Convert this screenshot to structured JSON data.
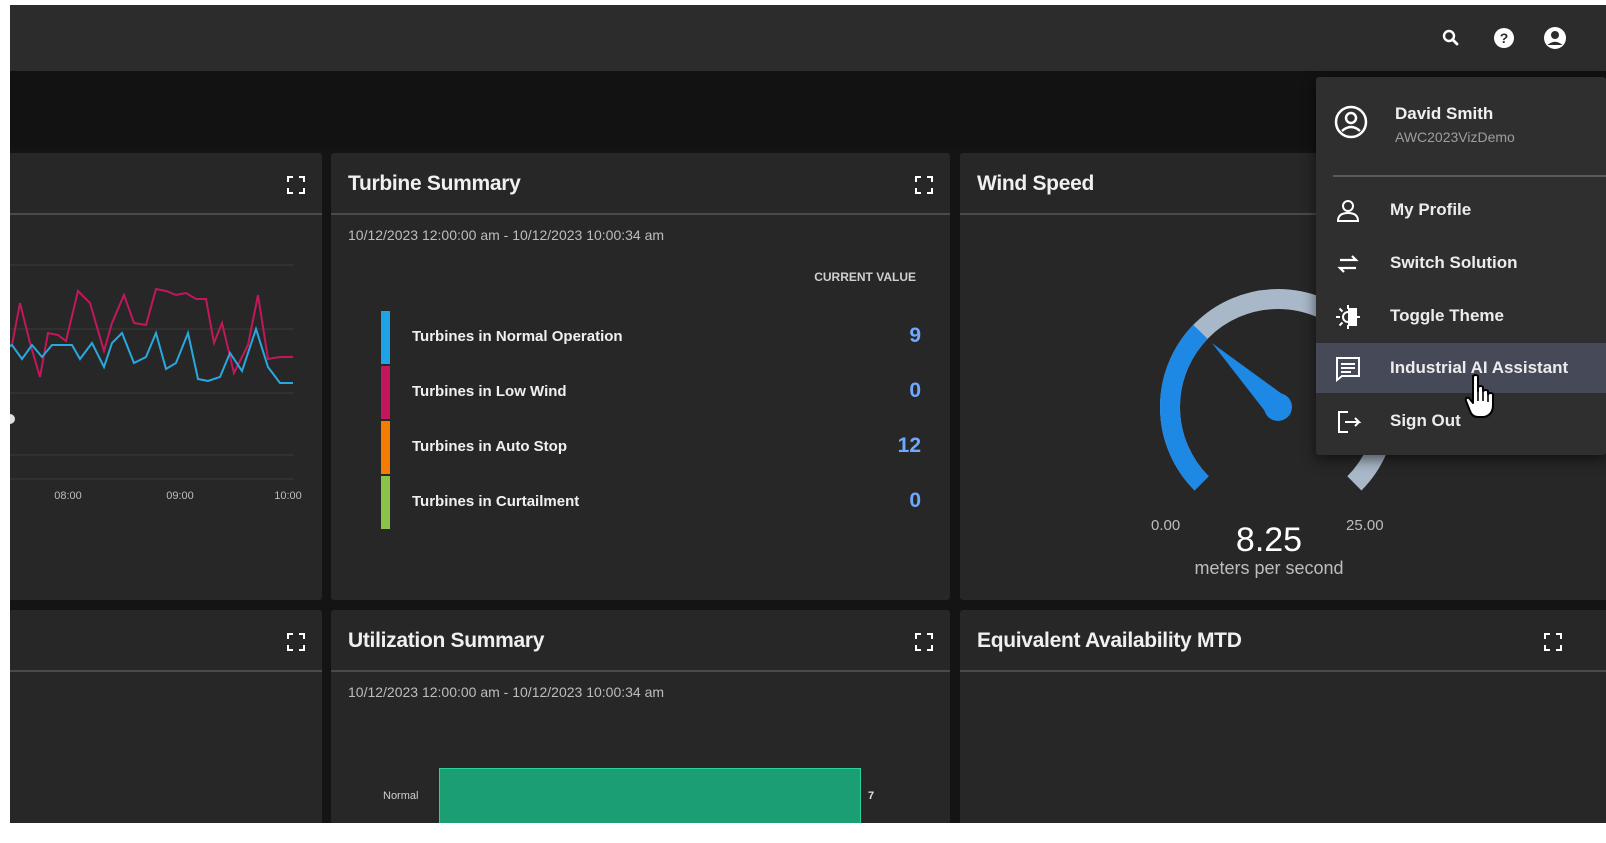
{
  "topbar": {
    "icons": [
      "search-icon",
      "help-icon",
      "account-icon"
    ]
  },
  "trend_card": {
    "x_ticks": [
      "08:00",
      "09:00",
      "10:00"
    ],
    "series_colors": [
      "#c2185b",
      "#29a8e0"
    ]
  },
  "turbine_summary": {
    "title": "Turbine Summary",
    "date_range": "10/12/2023 12:00:00 am - 10/12/2023 10:00:34 am",
    "column_header": "CURRENT VALUE",
    "rows": [
      {
        "label": "Turbines in Normal Operation",
        "value": "9",
        "color": "#1ea3e6"
      },
      {
        "label": "Turbines in Low Wind",
        "value": "0",
        "color": "#c2185b"
      },
      {
        "label": "Turbines in Auto Stop",
        "value": "12",
        "color": "#f57c00"
      },
      {
        "label": "Turbines in Curtailment",
        "value": "0",
        "color": "#8bc34a"
      }
    ]
  },
  "wind_speed": {
    "title": "Wind Speed",
    "min_label": "0.00",
    "max_label": "25.00",
    "value": "8.25",
    "unit": "meters per second",
    "gauge_fraction": 0.33,
    "colors": {
      "filled": "#1e88e5",
      "track": "#a9b8c9"
    }
  },
  "utilization_summary": {
    "title": "Utilization Summary",
    "date_range": "10/12/2023 12:00:00 am - 10/12/2023 10:00:34 am",
    "bar_label": "Normal",
    "bar_value": "7",
    "bar_color": "#1c9e75"
  },
  "equivalent_availability": {
    "title": "Equivalent Availability MTD"
  },
  "user_menu": {
    "name": "David Smith",
    "subtitle": "AWC2023VizDemo",
    "items": [
      {
        "label": "My Profile",
        "icon": "profile-icon"
      },
      {
        "label": "Switch Solution",
        "icon": "swap-icon"
      },
      {
        "label": "Toggle Theme",
        "icon": "theme-icon"
      },
      {
        "label": "Industrial AI Assistant",
        "icon": "chat-icon"
      },
      {
        "label": "Sign Out",
        "icon": "sign-out-icon"
      }
    ]
  }
}
